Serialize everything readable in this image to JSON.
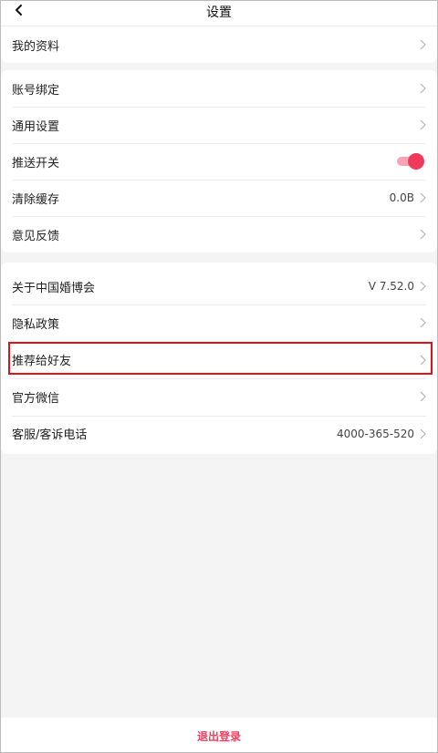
{
  "header": {
    "title": "设置"
  },
  "group1": [
    {
      "label": "我的资料"
    }
  ],
  "group2": [
    {
      "label": "账号绑定"
    },
    {
      "label": "通用设置"
    },
    {
      "label": "推送开关",
      "toggle_on": true
    },
    {
      "label": "清除缓存",
      "value": "0.0B"
    },
    {
      "label": "意见反馈"
    }
  ],
  "group3": [
    {
      "label": "关于中国婚博会",
      "value": "V 7.52.0"
    },
    {
      "label": "隐私政策"
    },
    {
      "label": "推荐给好友",
      "highlighted": true
    },
    {
      "label": "官方微信"
    },
    {
      "label": "客服/客诉电话",
      "value": "4000-365-520"
    }
  ],
  "logout": {
    "label": "退出登录"
  },
  "colors": {
    "accent": "#f13a5b",
    "highlight_border": "#e0101c"
  }
}
